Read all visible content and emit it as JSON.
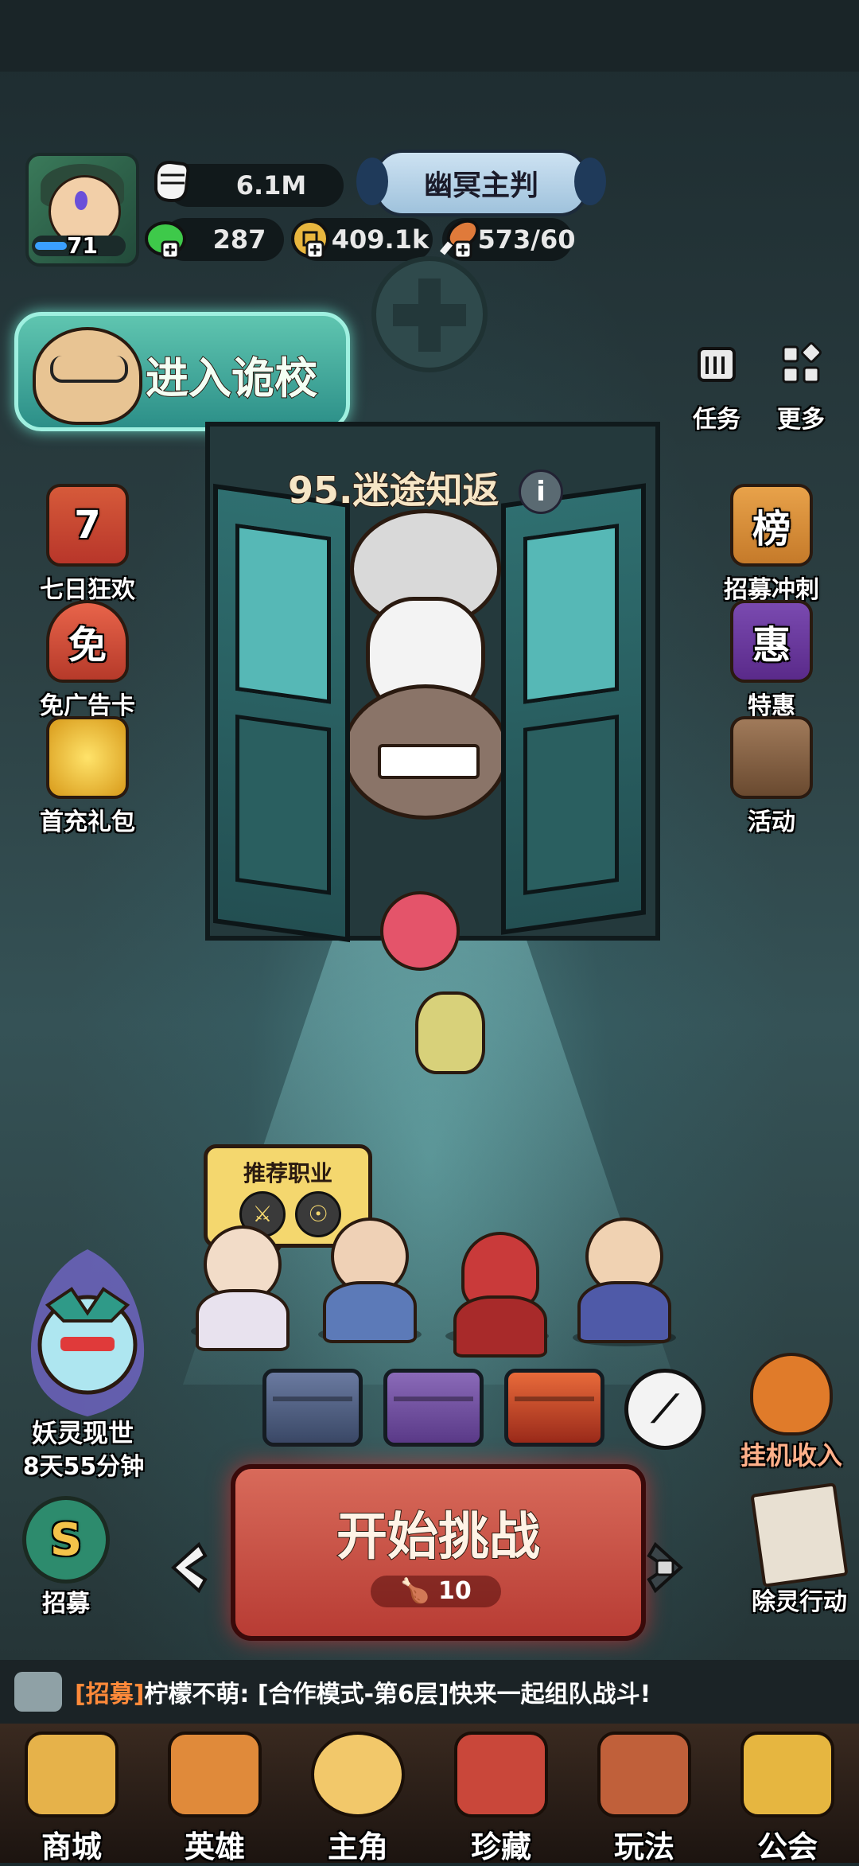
{
  "player": {
    "level": "71",
    "power": "6.1M",
    "title": "幽冥主判",
    "jade": "287",
    "coins": "409.1k",
    "stamina": "573/60"
  },
  "enter_school": {
    "label": "进入诡校"
  },
  "top_right": {
    "tasks_label": "任务",
    "more_label": "更多"
  },
  "stage": {
    "name": "95.迷途知返",
    "info": "i"
  },
  "left_menu": [
    {
      "label": "七日狂欢",
      "glyph": "7"
    },
    {
      "label": "免广告卡",
      "glyph": "免"
    },
    {
      "label": "首充礼包",
      "glyph": ""
    }
  ],
  "right_menu": [
    {
      "label": "招募冲刺",
      "glyph": "榜"
    },
    {
      "label": "特惠",
      "glyph": "惠"
    },
    {
      "label": "活动",
      "glyph": ""
    }
  ],
  "recommend": {
    "title": "推荐职业"
  },
  "event": {
    "name": "妖灵现世",
    "time": "8天55分钟"
  },
  "idle": {
    "label": "挂机收入"
  },
  "start": {
    "label": "开始挑战",
    "cost": "10"
  },
  "recruit": {
    "label": "招募",
    "glyph": "S"
  },
  "exorcise": {
    "label": "除灵行动"
  },
  "chat": {
    "tag": "[招募]",
    "message": "柠檬不萌: [合作模式-第6层]快来一起组队战斗!"
  },
  "nav": [
    {
      "label": "商城",
      "color": "#e6b24a"
    },
    {
      "label": "英雄",
      "color": "#e08a3a"
    },
    {
      "label": "主角",
      "color": "#f2c86a"
    },
    {
      "label": "珍藏",
      "color": "#c9473a"
    },
    {
      "label": "玩法",
      "color": "#c0603a"
    },
    {
      "label": "公会",
      "color": "#e6b640"
    }
  ]
}
